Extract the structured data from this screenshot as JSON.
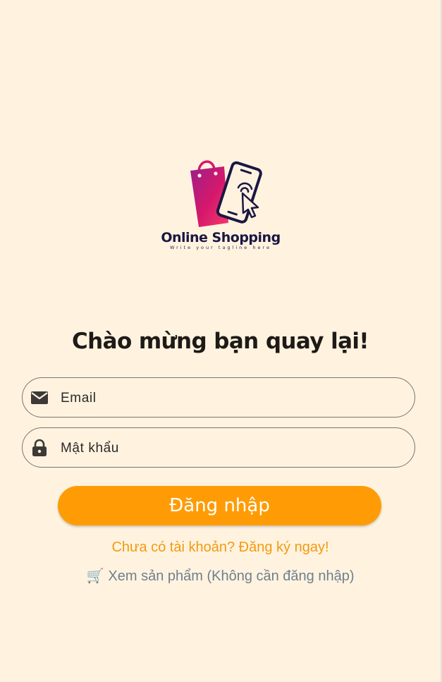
{
  "logo": {
    "title": "Online Shopping",
    "tagline": "Write your tagline here",
    "icon": "shopping-bag-phone-cursor-logo"
  },
  "welcome_text": "Chào mừng bạn quay lại!",
  "email_field": {
    "label": "Email",
    "icon": "mail-icon"
  },
  "password_field": {
    "label": "Mật khẩu",
    "icon": "lock-icon"
  },
  "login_button": {
    "label": "Đăng nhập"
  },
  "signup_link": "Chưa có tài khoản? Đăng ký ngay!",
  "browse_link": {
    "icon": "🛒",
    "label": "Xem sản phẩm (Không cần đăng nhập)"
  },
  "colors": {
    "background": "#fff3e0",
    "accent": "#ff9c05",
    "link": "#f39a0d",
    "secondary_link": "#6f7f8d",
    "logo_magenta": "#d6186c",
    "logo_navy": "#1b1743"
  }
}
